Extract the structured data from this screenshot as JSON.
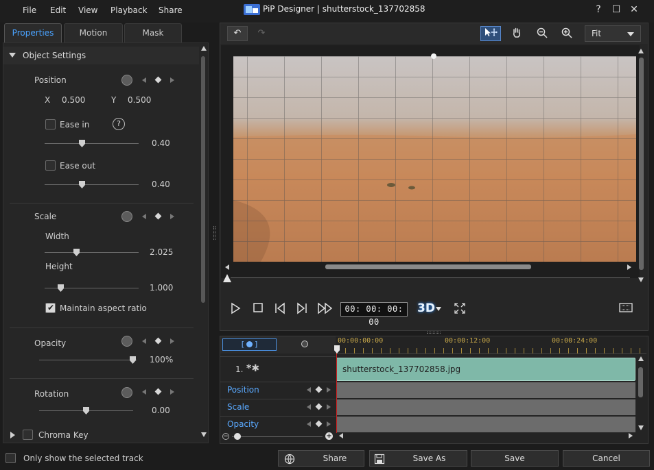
{
  "window": {
    "title": "PiP Designer  |  shutterstock_137702858",
    "help": "?",
    "maximize": "☐",
    "close": "✕"
  },
  "menu": {
    "file": "File",
    "edit": "Edit",
    "view": "View",
    "playback": "Playback",
    "share": "Share"
  },
  "tabs": {
    "properties": "Properties",
    "motion": "Motion",
    "mask": "Mask"
  },
  "object_settings": {
    "title": "Object Settings",
    "position": {
      "label": "Position",
      "x_label": "X",
      "x_value": "0.500",
      "y_label": "Y",
      "y_value": "0.500",
      "ease_in_label": "Ease in",
      "ease_in_value": "0.40",
      "ease_in_level": 0.4,
      "ease_out_label": "Ease out",
      "ease_out_value": "0.40",
      "ease_out_level": 0.4
    },
    "scale": {
      "label": "Scale",
      "width_label": "Width",
      "width_value": "2.025",
      "height_label": "Height",
      "height_value": "1.000",
      "maintain_aspect_label": "Maintain aspect ratio"
    },
    "opacity": {
      "label": "Opacity",
      "value": "100%",
      "level": 1.0
    },
    "rotation": {
      "label": "Rotation",
      "value": "0.00"
    },
    "chroma_key": {
      "label": "Chroma Key"
    }
  },
  "preview": {
    "undo": "↶",
    "redo": "↷",
    "zoom_select": "Fit"
  },
  "playback": {
    "timecode": "00: 00: 00: 00",
    "three_d": "3D"
  },
  "timeline": {
    "ruler": [
      "00:00:00:00",
      "00:00:12:00",
      "00:00:24:00"
    ],
    "track_index": "1.",
    "clip_name": "shutterstock_137702858.jpg",
    "rows": [
      "Position",
      "Scale",
      "Opacity"
    ]
  },
  "footer": {
    "only_show_selected": "Only show the selected track",
    "share": "Share",
    "save_as": "Save As",
    "save": "Save",
    "cancel": "Cancel"
  }
}
